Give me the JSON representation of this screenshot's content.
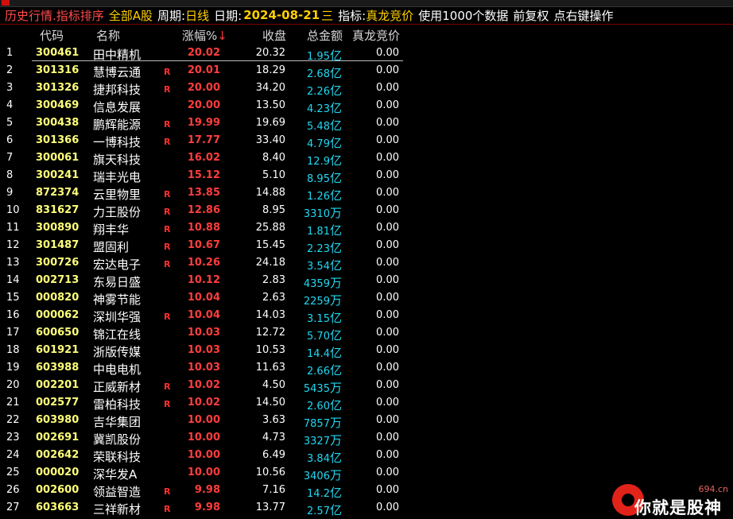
{
  "titlebar": {
    "mode": "历史行情.指标排序",
    "market": "全部A股",
    "period_label": "周期:",
    "period_value": "日线",
    "date_label": "日期:",
    "date_value": "2024-08-21",
    "weekday": "三",
    "indicator_label": "指标:",
    "indicator_value": "真龙竞价",
    "usage": "使用1000个数据",
    "adjust": "前复权",
    "hint": "点右键操作"
  },
  "columns": {
    "code": "代码",
    "name": "名称",
    "change": "涨幅%",
    "close": "收盘",
    "amount": "总金额",
    "indicator": "真龙竞价"
  },
  "rows": [
    {
      "idx": "1",
      "code": "300461",
      "name": "田中精机",
      "r": "",
      "change": "20.02",
      "close": "20.32",
      "amt": "1.95",
      "unit": "亿",
      "ind": "0.00"
    },
    {
      "idx": "2",
      "code": "301316",
      "name": "慧博云通",
      "r": "R",
      "change": "20.01",
      "close": "18.29",
      "amt": "2.68",
      "unit": "亿",
      "ind": "0.00"
    },
    {
      "idx": "3",
      "code": "301326",
      "name": "捷邦科技",
      "r": "R",
      "change": "20.00",
      "close": "34.20",
      "amt": "2.26",
      "unit": "亿",
      "ind": "0.00"
    },
    {
      "idx": "4",
      "code": "300469",
      "name": "信息发展",
      "r": "",
      "change": "20.00",
      "close": "13.50",
      "amt": "4.23",
      "unit": "亿",
      "ind": "0.00"
    },
    {
      "idx": "5",
      "code": "300438",
      "name": "鹏辉能源",
      "r": "R",
      "change": "19.99",
      "close": "19.69",
      "amt": "5.48",
      "unit": "亿",
      "ind": "0.00"
    },
    {
      "idx": "6",
      "code": "301366",
      "name": "一博科技",
      "r": "R",
      "change": "17.77",
      "close": "33.40",
      "amt": "4.79",
      "unit": "亿",
      "ind": "0.00"
    },
    {
      "idx": "7",
      "code": "300061",
      "name": "旗天科技",
      "r": "",
      "change": "16.02",
      "close": "8.40",
      "amt": "12.9",
      "unit": "亿",
      "ind": "0.00"
    },
    {
      "idx": "8",
      "code": "300241",
      "name": "瑞丰光电",
      "r": "",
      "change": "15.12",
      "close": "5.10",
      "amt": "8.95",
      "unit": "亿",
      "ind": "0.00"
    },
    {
      "idx": "9",
      "code": "872374",
      "name": "云里物里",
      "r": "R",
      "change": "13.85",
      "close": "14.88",
      "amt": "1.26",
      "unit": "亿",
      "ind": "0.00"
    },
    {
      "idx": "10",
      "code": "831627",
      "name": "力王股份",
      "r": "R",
      "change": "12.86",
      "close": "8.95",
      "amt": "3310",
      "unit": "万",
      "ind": "0.00"
    },
    {
      "idx": "11",
      "code": "300890",
      "name": "翔丰华",
      "r": "R",
      "change": "10.88",
      "close": "25.88",
      "amt": "1.81",
      "unit": "亿",
      "ind": "0.00"
    },
    {
      "idx": "12",
      "code": "301487",
      "name": "盟固利",
      "r": "R",
      "change": "10.67",
      "close": "15.45",
      "amt": "2.23",
      "unit": "亿",
      "ind": "0.00"
    },
    {
      "idx": "13",
      "code": "300726",
      "name": "宏达电子",
      "r": "R",
      "change": "10.26",
      "close": "24.18",
      "amt": "3.54",
      "unit": "亿",
      "ind": "0.00"
    },
    {
      "idx": "14",
      "code": "002713",
      "name": "东易日盛",
      "r": "",
      "change": "10.12",
      "close": "2.83",
      "amt": "4359",
      "unit": "万",
      "ind": "0.00"
    },
    {
      "idx": "15",
      "code": "000820",
      "name": "神雾节能",
      "r": "",
      "change": "10.04",
      "close": "2.63",
      "amt": "2259",
      "unit": "万",
      "ind": "0.00"
    },
    {
      "idx": "16",
      "code": "000062",
      "name": "深圳华强",
      "r": "R",
      "change": "10.04",
      "close": "14.03",
      "amt": "3.15",
      "unit": "亿",
      "ind": "0.00"
    },
    {
      "idx": "17",
      "code": "600650",
      "name": "锦江在线",
      "r": "",
      "change": "10.03",
      "close": "12.72",
      "amt": "5.70",
      "unit": "亿",
      "ind": "0.00"
    },
    {
      "idx": "18",
      "code": "601921",
      "name": "浙版传媒",
      "r": "",
      "change": "10.03",
      "close": "10.53",
      "amt": "14.4",
      "unit": "亿",
      "ind": "0.00"
    },
    {
      "idx": "19",
      "code": "603988",
      "name": "中电电机",
      "r": "",
      "change": "10.03",
      "close": "11.63",
      "amt": "2.66",
      "unit": "亿",
      "ind": "0.00"
    },
    {
      "idx": "20",
      "code": "002201",
      "name": "正威新材",
      "r": "R",
      "change": "10.02",
      "close": "4.50",
      "amt": "5435",
      "unit": "万",
      "ind": "0.00"
    },
    {
      "idx": "21",
      "code": "002577",
      "name": "雷柏科技",
      "r": "R",
      "change": "10.02",
      "close": "14.50",
      "amt": "2.60",
      "unit": "亿",
      "ind": "0.00"
    },
    {
      "idx": "22",
      "code": "603980",
      "name": "吉华集团",
      "r": "",
      "change": "10.00",
      "close": "3.63",
      "amt": "7857",
      "unit": "万",
      "ind": "0.00"
    },
    {
      "idx": "23",
      "code": "002691",
      "name": "冀凯股份",
      "r": "",
      "change": "10.00",
      "close": "4.73",
      "amt": "3327",
      "unit": "万",
      "ind": "0.00"
    },
    {
      "idx": "24",
      "code": "002642",
      "name": "荣联科技",
      "r": "",
      "change": "10.00",
      "close": "6.49",
      "amt": "3.84",
      "unit": "亿",
      "ind": "0.00"
    },
    {
      "idx": "25",
      "code": "000020",
      "name": "深华发A",
      "r": "",
      "change": "10.00",
      "close": "10.56",
      "amt": "3406",
      "unit": "万",
      "ind": "0.00"
    },
    {
      "idx": "26",
      "code": "002600",
      "name": "领益智造",
      "r": "R",
      "change": "9.98",
      "close": "7.16",
      "amt": "14.2",
      "unit": "亿",
      "ind": "0.00"
    },
    {
      "idx": "27",
      "code": "603663",
      "name": "三祥新材",
      "r": "R",
      "change": "9.98",
      "close": "13.77",
      "amt": "2.57",
      "unit": "亿",
      "ind": "0.00"
    }
  ],
  "watermark": {
    "url": "694.cn",
    "text": "你就是股神"
  },
  "colors": {
    "background": "#000000",
    "mode_text": "#ff4b4b",
    "value_text": "#ffd000",
    "code_text": "#ffff7a",
    "change_text": "#ff3d3d",
    "amount_text": "#21d7f0"
  }
}
